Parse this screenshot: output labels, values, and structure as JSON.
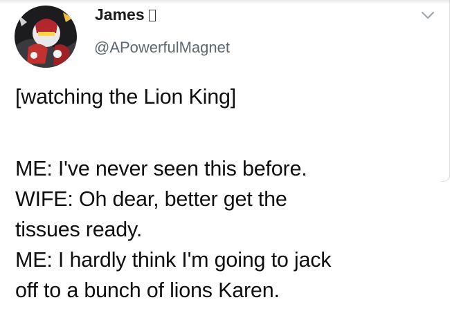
{
  "author": {
    "display_name": "James",
    "badge_icon": "unrendered-glyph-box",
    "handle": "@APowerfulMagnet"
  },
  "menu_icon": "chevron-down-icon",
  "tweet": {
    "lines": [
      "[watching the Lion King]",
      "ME: I've never seen this before.",
      "WIFE: Oh dear, better get the",
      "tissues ready.",
      "ME: I hardly think I'm going to jack",
      "off to a bunch of lions Karen."
    ]
  },
  "colors": {
    "text": "#0f0f0f",
    "handle": "#5b6770",
    "background": "#ffffff"
  }
}
